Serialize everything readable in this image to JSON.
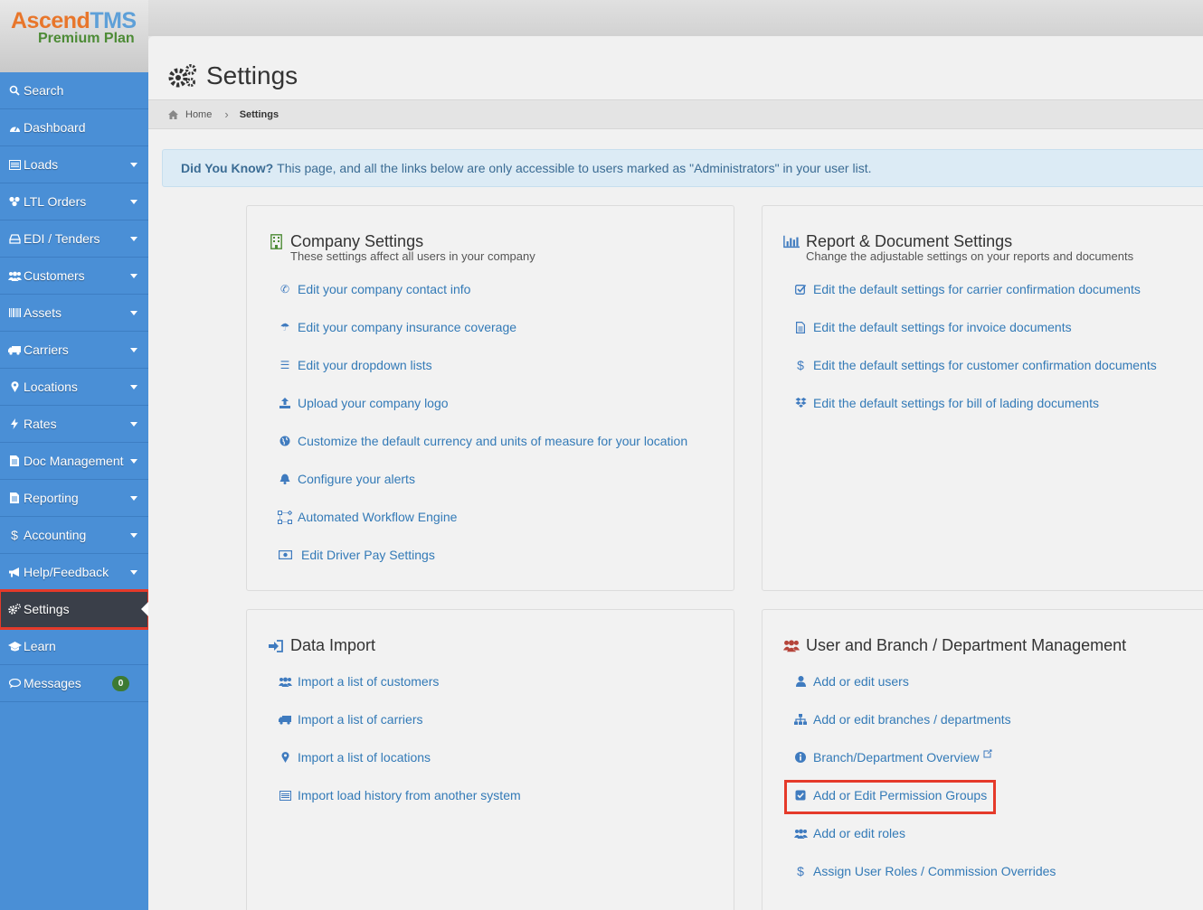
{
  "app": {
    "brand_part1": "Ascend",
    "brand_part2": "TMS",
    "plan": "Premium Plan"
  },
  "sidebar": {
    "items": [
      {
        "label": "Search",
        "icon": "search-icon",
        "caret": false
      },
      {
        "label": "Dashboard",
        "icon": "dashboard-icon",
        "caret": false
      },
      {
        "label": "Loads",
        "icon": "list-icon",
        "caret": true
      },
      {
        "label": "LTL Orders",
        "icon": "boxes-icon",
        "caret": true
      },
      {
        "label": "EDI / Tenders",
        "icon": "inbox-icon",
        "caret": true
      },
      {
        "label": "Customers",
        "icon": "users-icon",
        "caret": true
      },
      {
        "label": "Assets",
        "icon": "barcode-icon",
        "caret": true
      },
      {
        "label": "Carriers",
        "icon": "truck-icon",
        "caret": true
      },
      {
        "label": "Locations",
        "icon": "map-marker-icon",
        "caret": true
      },
      {
        "label": "Rates",
        "icon": "bolt-icon",
        "caret": true
      },
      {
        "label": "Doc Management",
        "icon": "document-icon",
        "caret": true
      },
      {
        "label": "Reporting",
        "icon": "report-icon",
        "caret": true
      },
      {
        "label": "Accounting",
        "icon": "dollar-icon",
        "caret": true
      },
      {
        "label": "Help/Feedback",
        "icon": "megaphone-icon",
        "caret": true
      },
      {
        "label": "Settings",
        "icon": "gears-icon",
        "caret": false,
        "active": true
      },
      {
        "label": "Learn",
        "icon": "graduation-cap-icon",
        "caret": false
      },
      {
        "label": "Messages",
        "icon": "chat-bubble-icon",
        "caret": false,
        "badge": "0"
      }
    ]
  },
  "page": {
    "title": "Settings",
    "breadcrumb": {
      "home": "Home",
      "current": "Settings"
    },
    "info": {
      "lead": "Did You Know?",
      "text": "This page, and all the links below are only accessible to users marked as \"Administrators\" in your user list."
    }
  },
  "company": {
    "title": "Company Settings",
    "subtitle": "These settings affect all users in your company",
    "links": [
      "Edit your company contact info",
      "Edit your company insurance coverage",
      "Edit your dropdown lists",
      "Upload your company logo",
      "Customize the default currency and units of measure for your location",
      "Configure your alerts",
      "Automated Workflow Engine",
      "Edit Driver Pay Settings"
    ]
  },
  "report": {
    "title": "Report & Document Settings",
    "subtitle": "Change the adjustable settings on your reports and documents",
    "links": [
      "Edit the default settings for carrier confirmation documents",
      "Edit the default settings for invoice documents",
      "Edit the default settings for customer confirmation documents",
      "Edit the default settings for bill of lading documents"
    ]
  },
  "import": {
    "title": "Data Import",
    "links": [
      "Import a list of customers",
      "Import a list of carriers",
      "Import a list of locations",
      "Import load history from another system"
    ]
  },
  "users": {
    "title": "User and Branch / Department Management",
    "links": [
      "Add or edit users",
      "Add or edit branches / departments",
      "Branch/Department Overview",
      "Add or Edit Permission Groups",
      "Add or edit roles",
      "Assign User Roles / Commission Overrides"
    ]
  },
  "colors": {
    "sidebar": "#4a8fd6",
    "active": "#3a3f49",
    "highlight": "#e53a2a",
    "link": "#337ab7"
  }
}
